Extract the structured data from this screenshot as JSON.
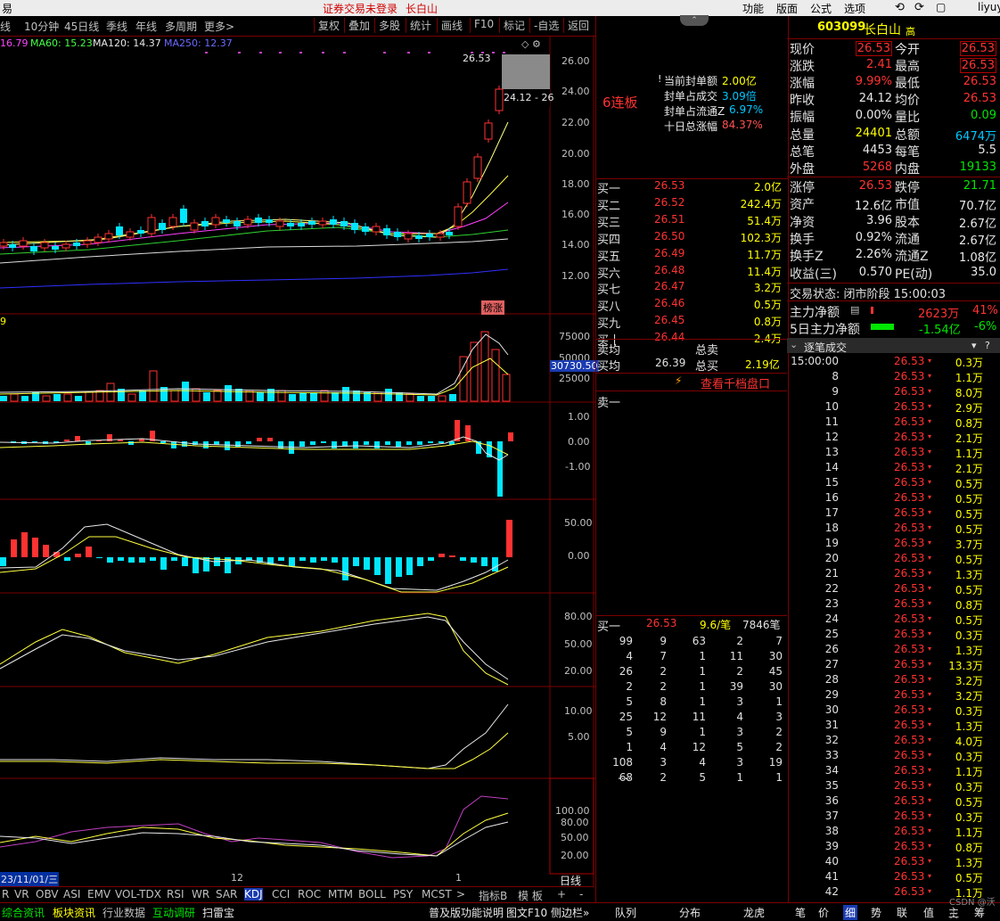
{
  "topbar": {
    "left": "易",
    "center": "证券交易未登录",
    "stock_name": "长白山",
    "menu": [
      "功能",
      "版面",
      "公式",
      "选项"
    ],
    "user": "liyuy"
  },
  "period_tabs": [
    "日线",
    "10分钟",
    "45日线",
    "季线",
    "年线",
    "多周期",
    "更多>"
  ],
  "toolbar": [
    "复权",
    "叠加",
    "多股",
    "统计",
    "画线",
    "F10",
    "标记",
    "-自选",
    "返回"
  ],
  "ma_legend": [
    {
      "label": "16.79",
      "color": "#ff44ff"
    },
    {
      "label": "MA60: 15.23",
      "color": "#44ff44"
    },
    {
      "label": "MA120: 14.37",
      "color": "#e8e8e8"
    },
    {
      "label": "MA250: 12.37",
      "color": "#4444ff"
    }
  ],
  "main_chart": {
    "y_ticks": [
      "26.00",
      "24.00",
      "22.00",
      "20.00",
      "18.00",
      "16.00",
      "14.00",
      "12.00"
    ],
    "high_label": "26.53",
    "prev_label": "24.12 - 26",
    "bang_label": "榜涨"
  },
  "volume_chart": {
    "y_ticks": [
      "75000",
      "50000",
      "25000"
    ],
    "current": "30730.50",
    "left_label": "9"
  },
  "macd_chart": {
    "y_ticks": [
      "1.00",
      "0.00",
      "-1.00"
    ]
  },
  "ind2_chart": {
    "y_ticks": [
      "50.00",
      "0.00"
    ]
  },
  "ind3_chart": {
    "y_ticks": [
      "80.00",
      "50.00",
      "20.00"
    ]
  },
  "ind4_chart": {
    "y_ticks": [
      "10.00",
      "5.00"
    ]
  },
  "ind5_chart": {
    "y_ticks": [
      "100.00",
      "80.00",
      "50.00",
      "20.00"
    ]
  },
  "x_axis": {
    "date": "23/11/01/三",
    "mid": "12",
    "right": "1"
  },
  "indicator_tabs": [
    "R",
    "VR",
    "OBV",
    "ASI",
    "EMV",
    "VOL-TDX",
    "RSI",
    "WR",
    "SAR",
    "KDJ",
    "CCI",
    "ROC",
    "MTM",
    "BOLL",
    "PSY",
    "MCST",
    ">"
  ],
  "indicator_right": [
    "指标B",
    "模 板",
    "+",
    "-"
  ],
  "bottom_tabs": [
    "综合资讯",
    "板块资讯",
    "行业数据",
    "互动调研",
    "扫雷宝"
  ],
  "bottom_right": [
    "普及版功能说明",
    "图文F10",
    "侧边栏»"
  ],
  "day_label": "日线",
  "seal": {
    "title": "6连板",
    "rows": [
      {
        "label": "当前封单额",
        "value": "2.00亿"
      },
      {
        "label": "封单占成交",
        "value": "3.09倍"
      },
      {
        "label": "封单占流通Z",
        "value": "6.97%"
      },
      {
        "label": "十日总涨幅",
        "value": "84.37%"
      }
    ]
  },
  "orderbook": {
    "bids": [
      {
        "label": "买一",
        "price": "26.53",
        "vol": "2.0亿"
      },
      {
        "label": "买二",
        "price": "26.52",
        "vol": "242.4万"
      },
      {
        "label": "买三",
        "price": "26.51",
        "vol": "51.4万"
      },
      {
        "label": "买四",
        "price": "26.50",
        "vol": "102.3万"
      },
      {
        "label": "买五",
        "price": "26.49",
        "vol": "11.7万"
      },
      {
        "label": "买六",
        "price": "26.48",
        "vol": "11.4万"
      },
      {
        "label": "买七",
        "price": "26.47",
        "vol": "3.2万"
      },
      {
        "label": "买八",
        "price": "26.46",
        "vol": "0.5万"
      },
      {
        "label": "买九",
        "price": "26.45",
        "vol": "0.8万"
      },
      {
        "label": "买十",
        "price": "26.44",
        "vol": "2.4万"
      }
    ],
    "sell_avg_label": "卖均",
    "sell_total_label": "总卖",
    "buy_avg_label": "买均",
    "buy_avg": "26.39",
    "buy_total_label": "总买",
    "buy_total": "2.19亿",
    "thousand_btn": "查看千档盘口",
    "ask1": "卖一"
  },
  "detail": {
    "header": {
      "label": "买一",
      "price": "26.53",
      "per": "9.6/笔",
      "count": "7846笔"
    },
    "rows": [
      [
        "99",
        "9",
        "63",
        "2",
        "7"
      ],
      [
        "4",
        "7",
        "1",
        "11",
        "30"
      ],
      [
        "26",
        "2",
        "1",
        "2",
        "45"
      ],
      [
        "2",
        "2",
        "1",
        "39",
        "30"
      ],
      [
        "5",
        "8",
        "1",
        "3",
        "1"
      ],
      [
        "25",
        "12",
        "11",
        "4",
        "3"
      ],
      [
        "5",
        "9",
        "1",
        "3",
        "2"
      ],
      [
        "1",
        "4",
        "12",
        "5",
        "2"
      ],
      [
        "108",
        "3",
        "4",
        "3",
        "19"
      ],
      [
        "68",
        "2",
        "5",
        "1",
        "1"
      ]
    ],
    "more": "...."
  },
  "quote": {
    "code": "603099",
    "name": "长白山",
    "tag": "高",
    "rows": [
      [
        {
          "l": "现价",
          "v": "26.53",
          "c": "red",
          "box": true
        },
        {
          "l": "今开",
          "v": "26.53",
          "c": "red",
          "box": true
        }
      ],
      [
        {
          "l": "涨跌",
          "v": "2.41",
          "c": "red"
        },
        {
          "l": "最高",
          "v": "26.53",
          "c": "red",
          "box": true
        }
      ],
      [
        {
          "l": "涨幅",
          "v": "9.99%",
          "c": "red"
        },
        {
          "l": "最低",
          "v": "26.53",
          "c": "red"
        }
      ],
      [
        {
          "l": "昨收",
          "v": "24.12",
          "c": "wht"
        },
        {
          "l": "均价",
          "v": "26.53",
          "c": "red"
        }
      ],
      [
        {
          "l": "振幅",
          "v": "0.00%",
          "c": "wht"
        },
        {
          "l": "量比",
          "v": "0.09",
          "c": "grn"
        }
      ],
      [
        {
          "l": "总量",
          "v": "24401",
          "c": "yel"
        },
        {
          "l": "总额",
          "v": "6474万",
          "c": "cyan"
        }
      ],
      [
        {
          "l": "总笔",
          "v": "4453",
          "c": "wht"
        },
        {
          "l": "每笔",
          "v": "5.5",
          "c": "wht"
        }
      ],
      [
        {
          "l": "外盘",
          "v": "5268",
          "c": "red"
        },
        {
          "l": "内盘",
          "v": "19133",
          "c": "grn"
        }
      ]
    ],
    "rows2": [
      [
        {
          "l": "涨停",
          "v": "26.53",
          "c": "red"
        },
        {
          "l": "跌停",
          "v": "21.71",
          "c": "grn"
        }
      ],
      [
        {
          "l": "资产",
          "v": "12.6亿",
          "c": "wht"
        },
        {
          "l": "市值",
          "v": "70.7亿",
          "c": "wht"
        }
      ],
      [
        {
          "l": "净资",
          "v": "3.96",
          "c": "wht"
        },
        {
          "l": "股本",
          "v": "2.67亿",
          "c": "wht"
        }
      ],
      [
        {
          "l": "换手",
          "v": "0.92%",
          "c": "wht"
        },
        {
          "l": "流通",
          "v": "2.67亿",
          "c": "wht"
        }
      ],
      [
        {
          "l": "换手Z",
          "v": "2.26%",
          "c": "wht"
        },
        {
          "l": "流通Z",
          "v": "1.08亿",
          "c": "wht"
        }
      ],
      [
        {
          "l": "收益(三)",
          "v": "0.570",
          "c": "wht"
        },
        {
          "l": "PE(动)",
          "v": "35.0",
          "c": "wht"
        }
      ]
    ],
    "status_label": "交易状态: 闭市阶段 15:00:03",
    "main_net_label": "主力净额",
    "main_net_value": "2623万",
    "main_net_pct": "41%",
    "main5_label": "5日主力净额",
    "main5_value": "-1.54亿",
    "main5_pct": "-6%"
  },
  "ticks": {
    "title": "逐笔成交",
    "rows": [
      {
        "t": "15:00:00",
        "p": "26.53",
        "a": "0.3万"
      },
      {
        "t": "8",
        "p": "26.53",
        "a": "1.1万"
      },
      {
        "t": "9",
        "p": "26.53",
        "a": "8.0万"
      },
      {
        "t": "10",
        "p": "26.53",
        "a": "2.9万"
      },
      {
        "t": "11",
        "p": "26.53",
        "a": "0.8万"
      },
      {
        "t": "12",
        "p": "26.53",
        "a": "2.1万"
      },
      {
        "t": "13",
        "p": "26.53",
        "a": "1.1万"
      },
      {
        "t": "14",
        "p": "26.53",
        "a": "2.1万"
      },
      {
        "t": "15",
        "p": "26.53",
        "a": "0.5万"
      },
      {
        "t": "16",
        "p": "26.53",
        "a": "0.5万"
      },
      {
        "t": "17",
        "p": "26.53",
        "a": "0.5万"
      },
      {
        "t": "18",
        "p": "26.53",
        "a": "0.5万"
      },
      {
        "t": "19",
        "p": "26.53",
        "a": "3.7万"
      },
      {
        "t": "20",
        "p": "26.53",
        "a": "0.5万"
      },
      {
        "t": "21",
        "p": "26.53",
        "a": "1.3万"
      },
      {
        "t": "22",
        "p": "26.53",
        "a": "0.5万"
      },
      {
        "t": "23",
        "p": "26.53",
        "a": "0.8万"
      },
      {
        "t": "24",
        "p": "26.53",
        "a": "0.5万"
      },
      {
        "t": "25",
        "p": "26.53",
        "a": "0.3万"
      },
      {
        "t": "26",
        "p": "26.53",
        "a": "1.3万"
      },
      {
        "t": "27",
        "p": "26.53",
        "a": "13.3万"
      },
      {
        "t": "28",
        "p": "26.53",
        "a": "3.2万"
      },
      {
        "t": "29",
        "p": "26.53",
        "a": "3.2万"
      },
      {
        "t": "30",
        "p": "26.53",
        "a": "0.3万"
      },
      {
        "t": "31",
        "p": "26.53",
        "a": "1.3万"
      },
      {
        "t": "32",
        "p": "26.53",
        "a": "4.0万"
      },
      {
        "t": "33",
        "p": "26.53",
        "a": "0.3万"
      },
      {
        "t": "34",
        "p": "26.53",
        "a": "1.1万"
      },
      {
        "t": "35",
        "p": "26.53",
        "a": "0.3万"
      },
      {
        "t": "36",
        "p": "26.53",
        "a": "0.5万"
      },
      {
        "t": "37",
        "p": "26.53",
        "a": "0.3万"
      },
      {
        "t": "38",
        "p": "26.53",
        "a": "1.1万"
      },
      {
        "t": "39",
        "p": "26.53",
        "a": "0.8万"
      },
      {
        "t": "40",
        "p": "26.53",
        "a": "1.3万"
      },
      {
        "t": "41",
        "p": "26.53",
        "a": "0.5万"
      },
      {
        "t": "42",
        "p": "26.53",
        "a": "1.1万"
      }
    ]
  },
  "right_tabs_mid": [
    "队列",
    "分布",
    "龙虎"
  ],
  "right_tabs": [
    "笔",
    "价",
    "细",
    "势",
    "联",
    "值",
    "主",
    "筹"
  ],
  "watermark": "CSDN @沃火"
}
